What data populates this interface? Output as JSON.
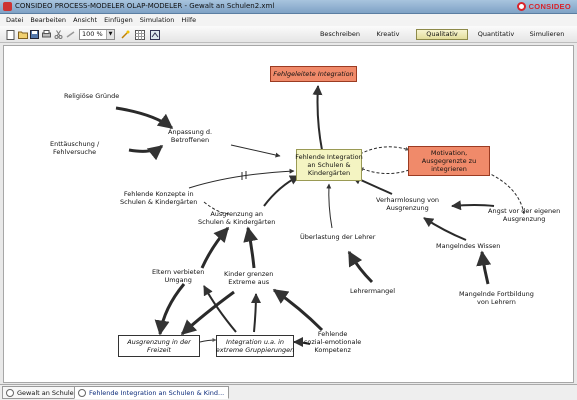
{
  "window": {
    "title": "CONSIDEO PROCESS-MODELER OLAP-MODELER - Gewalt an Schulen2.xml",
    "logo_text": "CONSIDEO"
  },
  "menu": [
    "Datei",
    "Bearbeiten",
    "Ansicht",
    "Einfügen",
    "Simulation",
    "Hilfe"
  ],
  "toolbar": {
    "zoom": "100 %",
    "icons": [
      "new-icon",
      "open-icon",
      "save-icon",
      "print-icon",
      "cut-icon",
      "link-icon",
      "wizard-icon",
      "grid-icon",
      "export-icon"
    ]
  },
  "modes": {
    "items": [
      "Beschreiben",
      "Kreativ",
      "Qualitativ",
      "Quantitativ",
      "Simulieren"
    ],
    "active": "Qualitativ"
  },
  "diagram": {
    "nodes": {
      "religioese_gruende": "Religiöse Gründe",
      "enttaeuschung": "Enttäuschung /\nFehlversuche",
      "anpassung": "Anpassung d.\nBetroffenen",
      "fehlende_konzepte": "Fehlende Konzepte in\nSchulen & Kindergärten",
      "fehlgeleitete_integration": "Fehlgeleitete Integration",
      "fehlende_integration": "Fehlende Integration\nan Schulen &\nKindergärten",
      "motivation": "Motivation,\nAusgegrenzte zu\nintegrieren",
      "verharmlosung": "Verharmlosung von\nAusgrenzung",
      "angst": "Angst vor der eigenen\nAusgrenzung",
      "ausgrenzung_schulen": "Ausgrenzung an\nSchulen & Kindergärten",
      "ueberlastung": "Überlastung der Lehrer",
      "mangelndes_wissen": "Mangelndes Wissen",
      "eltern_verbieten": "Eltern verbieten\nUmgang",
      "kinder_grenzen": "Kinder grenzen\nExtreme aus",
      "lehrermangel": "Lehrermangel",
      "mangelnde_fortbildung": "Mangelnde Fortbildung\nvon Lehrern",
      "ausgrenzung_freizeit": "Ausgrenzung in der\nFreizeit",
      "integration_extreme": "Integration u.a. in\nextreme Gruppierungen",
      "fehlende_kompetenz": "Fehlende\nsozial-emotionale\nKompetenz"
    }
  },
  "status_tabs": [
    {
      "label": "Gewalt an Schulen",
      "active": false
    },
    {
      "label": "Fehlende Integration an Schulen & Kind...",
      "active": true
    }
  ],
  "colors": {
    "red_node": "#f08a6a",
    "yellow_node": "#f4f4c2",
    "active_mode": "#e3dd9c"
  }
}
